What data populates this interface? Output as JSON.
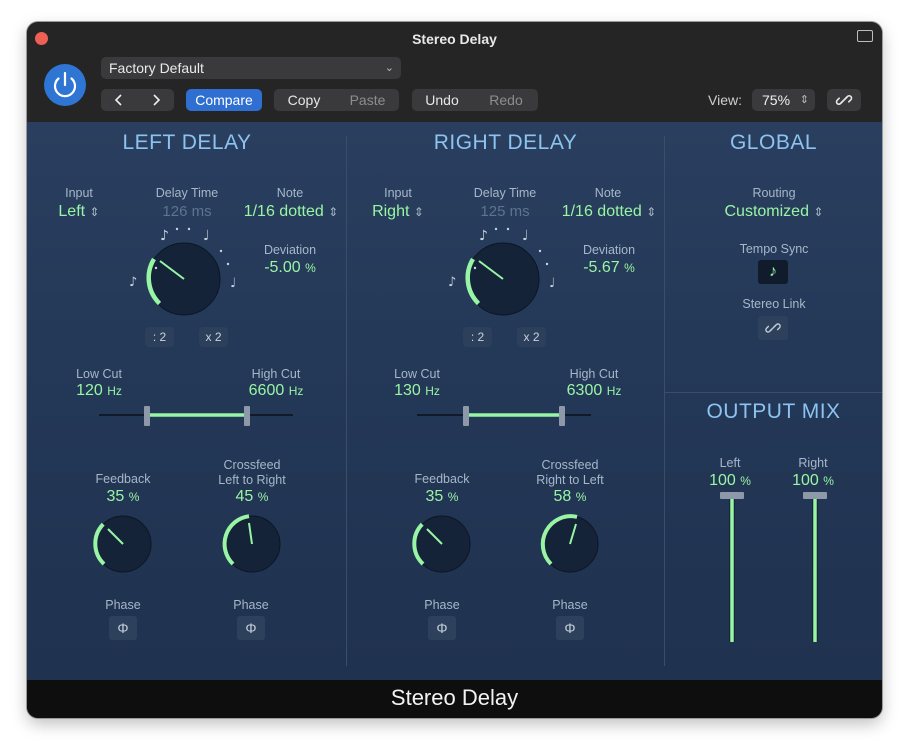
{
  "window": {
    "title": "Stereo Delay",
    "footer_title": "Stereo Delay"
  },
  "toolbar": {
    "preset": "Factory Default",
    "compare": "Compare",
    "copy": "Copy",
    "paste": "Paste",
    "undo": "Undo",
    "redo": "Redo",
    "view_label": "View:",
    "view_value": "75%"
  },
  "left_delay": {
    "heading": "LEFT DELAY",
    "input_label": "Input",
    "input_value": "Left",
    "delay_time_label": "Delay Time",
    "delay_time_value": "126 ms",
    "note_label": "Note",
    "note_value": "1/16 dotted",
    "deviation_label": "Deviation",
    "deviation_value": "-5.00",
    "deviation_unit": "%",
    "div2": ": 2",
    "mul2": "x 2",
    "low_cut_label": "Low Cut",
    "low_cut_value": "120",
    "low_cut_unit": "Hz",
    "high_cut_label": "High Cut",
    "high_cut_value": "6600",
    "high_cut_unit": "Hz",
    "feedback_label": "Feedback",
    "feedback_value": "35",
    "feedback_unit": "%",
    "crossfeed_label_1": "Crossfeed",
    "crossfeed_label_2": "Left to Right",
    "crossfeed_value": "45",
    "crossfeed_unit": "%",
    "phase_label_1": "Phase",
    "phase_label_2": "Phase"
  },
  "right_delay": {
    "heading": "RIGHT DELAY",
    "input_label": "Input",
    "input_value": "Right",
    "delay_time_label": "Delay Time",
    "delay_time_value": "125 ms",
    "note_label": "Note",
    "note_value": "1/16 dotted",
    "deviation_label": "Deviation",
    "deviation_value": "-5.67",
    "deviation_unit": "%",
    "div2": ": 2",
    "mul2": "x 2",
    "low_cut_label": "Low Cut",
    "low_cut_value": "130",
    "low_cut_unit": "Hz",
    "high_cut_label": "High Cut",
    "high_cut_value": "6300",
    "high_cut_unit": "Hz",
    "feedback_label": "Feedback",
    "feedback_value": "35",
    "feedback_unit": "%",
    "crossfeed_label_1": "Crossfeed",
    "crossfeed_label_2": "Right to Left",
    "crossfeed_value": "58",
    "crossfeed_unit": "%",
    "phase_label_1": "Phase",
    "phase_label_2": "Phase"
  },
  "global": {
    "heading": "GLOBAL",
    "routing_label": "Routing",
    "routing_value": "Customized",
    "tempo_sync_label": "Tempo Sync",
    "stereo_link_label": "Stereo Link"
  },
  "output_mix": {
    "heading": "OUTPUT MIX",
    "left_label": "Left",
    "left_value": "100",
    "left_unit": "%",
    "right_label": "Right",
    "right_value": "100",
    "right_unit": "%"
  },
  "colors": {
    "accent_green": "#98f5a4",
    "heading_blue": "#8cc3f0",
    "power_blue": "#2f76d4",
    "compare_blue": "#2f6fd1"
  },
  "icons": [
    "close-icon",
    "expand-icon",
    "power-icon",
    "chevron-down-icon",
    "back-icon",
    "forward-icon",
    "link-icon",
    "phase-icon",
    "note-icon"
  ]
}
